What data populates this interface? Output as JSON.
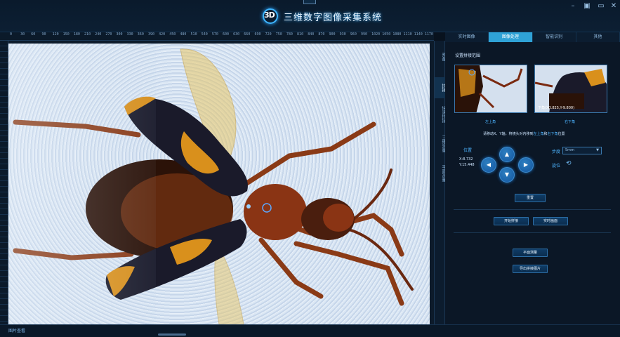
{
  "window": {
    "title": "三维数字图像采集系统",
    "logo_text": "3D"
  },
  "ruler": {
    "ticks": [
      "0",
      "30",
      "60",
      "90",
      "120",
      "150",
      "180",
      "210",
      "240",
      "270",
      "300",
      "330",
      "360",
      "390",
      "420",
      "450",
      "480",
      "510",
      "540",
      "570",
      "600",
      "630",
      "660",
      "690",
      "720",
      "750",
      "780",
      "810",
      "840",
      "870",
      "900",
      "930",
      "960",
      "990",
      "1020",
      "1050",
      "1080",
      "1110",
      "1140",
      "1170"
    ]
  },
  "side_tabs": [
    {
      "label": "预备"
    },
    {
      "label": "拼接"
    },
    {
      "label": "快速拼接"
    },
    {
      "label": "三维测量"
    },
    {
      "label": "平面测量"
    }
  ],
  "tabs": [
    {
      "label": "实时图像"
    },
    {
      "label": "图像处理"
    },
    {
      "label": "智能识别"
    },
    {
      "label": "其他"
    }
  ],
  "panel": {
    "section_title": "设置拼接范围",
    "thumb_left_caption": "左上角",
    "thumb_right_caption": "右下角",
    "thumb_right_overlay": "下角(XO.825,Y-9.800)",
    "hint_prefix": "请移动X、Y轴，将镜头对内移到",
    "hint_left": "左上角",
    "hint_mid": "和",
    "hint_right": "右下角",
    "hint_suffix": "位置",
    "position_label": "位置",
    "coord_x": "X:8.732",
    "coord_y": "Y:15.448",
    "step_label": "步度",
    "step_value": "5mm",
    "rotate_label": "旋位",
    "reset_button": "重置",
    "start_stitch_button": "开始拼接",
    "realtime_button": "实时画面",
    "plane_measure_button": "平面测量",
    "export_button": "导出拼接图片"
  },
  "status": {
    "left_text": "图片查看"
  },
  "colors": {
    "accent": "#2fa2d6",
    "link": "#4db4ff",
    "background": "#08121e"
  }
}
